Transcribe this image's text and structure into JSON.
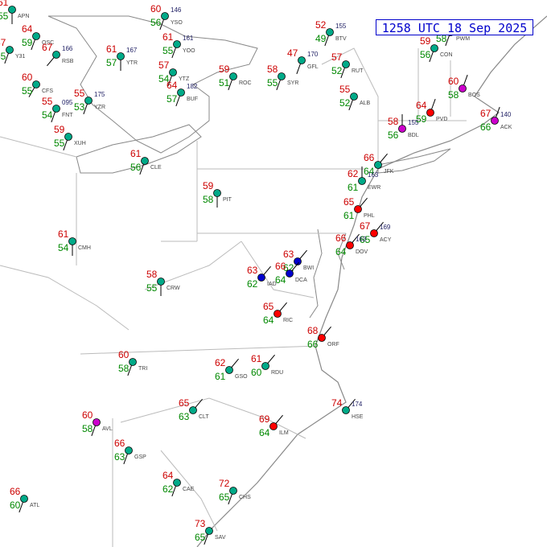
{
  "header": {
    "timestamp": "1258 UTC 18 Sep 2025"
  },
  "legend_colors": {
    "temperature": "#cc0000",
    "dewpoint": "#008800",
    "pressure": "#222266",
    "state_border": "#bbbbbb",
    "coast": "#888888",
    "overcast": "#0000cc",
    "ceiling_low": "#cc00cc",
    "ceiling_marginal": "#ff0000",
    "mostly_clear": "#00aa88",
    "timestamp_box": "#0000cc"
  },
  "stations": [
    {
      "id": "APN",
      "temp": "61",
      "dew": "55",
      "press": "",
      "cover": "green",
      "wind": 180
    },
    {
      "id": "OSC",
      "temp": "64",
      "dew": "59",
      "press": "",
      "cover": "green",
      "wind": 200
    },
    {
      "id": "Y31",
      "temp": "67",
      "dew": "55",
      "press": "",
      "cover": "green",
      "wind": 200
    },
    {
      "id": "CFS",
      "temp": "60",
      "dew": "55",
      "press": "",
      "cover": "green",
      "wind": 210
    },
    {
      "id": "RSB",
      "temp": "67",
      "dew": "",
      "press": "166",
      "cover": "green",
      "wind": 220
    },
    {
      "id": "FNT",
      "temp": "55",
      "dew": "54",
      "press": "095",
      "cover": "green",
      "wind": 200
    },
    {
      "id": "YZR",
      "temp": "55",
      "dew": "53",
      "press": "175",
      "cover": "green",
      "wind": 200
    },
    {
      "id": "XUH",
      "temp": "59",
      "dew": "55",
      "press": "",
      "cover": "green",
      "wind": 200
    },
    {
      "id": "YTR",
      "temp": "61",
      "dew": "57",
      "press": "167",
      "cover": "green",
      "wind": 180
    },
    {
      "id": "YSO",
      "temp": "60",
      "dew": "56",
      "press": "146",
      "cover": "green",
      "wind": 200
    },
    {
      "id": "YOO",
      "temp": "61",
      "dew": "55",
      "press": "161",
      "cover": "green",
      "wind": 200
    },
    {
      "id": "YTZ",
      "temp": "57",
      "dew": "54",
      "press": "",
      "cover": "green",
      "wind": 200
    },
    {
      "id": "BUF",
      "temp": "64",
      "dew": "57",
      "press": "182",
      "cover": "green",
      "wind": 200
    },
    {
      "id": "ROC",
      "temp": "59",
      "dew": "51",
      "press": "",
      "cover": "green",
      "wind": 200
    },
    {
      "id": "SYR",
      "temp": "58",
      "dew": "55",
      "press": "",
      "cover": "green",
      "wind": 200
    },
    {
      "id": "ALB",
      "temp": "55",
      "dew": "52",
      "press": "",
      "cover": "green",
      "wind": 200
    },
    {
      "id": "GFL",
      "temp": "47",
      "dew": "",
      "press": "170",
      "cover": "green",
      "wind": 200
    },
    {
      "id": "BTV",
      "temp": "52",
      "dew": "49",
      "press": "155",
      "cover": "green",
      "wind": 200
    },
    {
      "id": "RUT",
      "temp": "57",
      "dew": "52",
      "press": "",
      "cover": "green",
      "wind": 200
    },
    {
      "id": "CON",
      "temp": "59",
      "dew": "56",
      "press": "",
      "cover": "green",
      "wind": 200
    },
    {
      "id": "PWM",
      "temp": "59",
      "dew": "58",
      "press": "",
      "cover": "green",
      "wind": 200
    },
    {
      "id": "BOS",
      "temp": "60",
      "dew": "58",
      "press": "",
      "cover": "magenta",
      "wind": 20
    },
    {
      "id": "PVD",
      "temp": "64",
      "dew": "59",
      "press": "",
      "cover": "red",
      "wind": 20
    },
    {
      "id": "ACK",
      "temp": "67",
      "dew": "66",
      "press": "140",
      "cover": "magenta",
      "wind": 20
    },
    {
      "id": "BDL",
      "temp": "58",
      "dew": "56",
      "press": "155",
      "cover": "magenta",
      "wind": 0
    },
    {
      "id": "JFK",
      "temp": "66",
      "dew": "64",
      "press": "",
      "cover": "green",
      "wind": 40
    },
    {
      "id": "EWR",
      "temp": "62",
      "dew": "61",
      "press": "163",
      "cover": "green",
      "wind": 0
    },
    {
      "id": "PHL",
      "temp": "65",
      "dew": "61",
      "press": "",
      "cover": "red",
      "wind": 40
    },
    {
      "id": "ACY",
      "temp": "67",
      "dew": "65",
      "press": "169",
      "cover": "red",
      "wind": 40
    },
    {
      "id": "DOV",
      "temp": "66",
      "dew": "64",
      "press": "163",
      "cover": "red",
      "wind": 40
    },
    {
      "id": "BWI",
      "temp": "63",
      "dew": "62",
      "press": "",
      "cover": "blue",
      "wind": 40
    },
    {
      "id": "DCA",
      "temp": "66",
      "dew": "64",
      "press": "",
      "cover": "blue",
      "wind": 40
    },
    {
      "id": "IAD",
      "temp": "63",
      "dew": "62",
      "press": "",
      "cover": "blue",
      "wind": 40
    },
    {
      "id": "RIC",
      "temp": "65",
      "dew": "64",
      "press": "",
      "cover": "red",
      "wind": 40
    },
    {
      "id": "ORF",
      "temp": "68",
      "dew": "66",
      "press": "",
      "cover": "red",
      "wind": 40
    },
    {
      "id": "RDU",
      "temp": "61",
      "dew": "60",
      "press": "",
      "cover": "green",
      "wind": 40
    },
    {
      "id": "GSO",
      "temp": "62",
      "dew": "61",
      "press": "",
      "cover": "green",
      "wind": 40
    },
    {
      "id": "CLT",
      "temp": "65",
      "dew": "63",
      "press": "",
      "cover": "green",
      "wind": 40
    },
    {
      "id": "ILM",
      "temp": "69",
      "dew": "64",
      "press": "",
      "cover": "red",
      "wind": 40
    },
    {
      "id": "HSE",
      "temp": "74",
      "dew": "",
      "press": "174",
      "cover": "green",
      "wind": 40
    },
    {
      "id": "CRW",
      "temp": "58",
      "dew": "55",
      "press": "",
      "cover": "green",
      "wind": 180
    },
    {
      "id": "PIT",
      "temp": "59",
      "dew": "58",
      "press": "",
      "cover": "green",
      "wind": 180
    },
    {
      "id": "CLE",
      "temp": "61",
      "dew": "56",
      "press": "",
      "cover": "green",
      "wind": 200
    },
    {
      "id": "CMH",
      "temp": "61",
      "dew": "54",
      "press": "",
      "cover": "green",
      "wind": 180
    },
    {
      "id": "TRI",
      "temp": "60",
      "dew": "58",
      "press": "",
      "cover": "green",
      "wind": 200
    },
    {
      "id": "AVL",
      "temp": "60",
      "dew": "58",
      "press": "",
      "cover": "magenta",
      "wind": 200
    },
    {
      "id": "GSP",
      "temp": "66",
      "dew": "63",
      "press": "",
      "cover": "green",
      "wind": 200
    },
    {
      "id": "CAE",
      "temp": "64",
      "dew": "62",
      "press": "",
      "cover": "green",
      "wind": 200
    },
    {
      "id": "CHS",
      "temp": "72",
      "dew": "65",
      "press": "",
      "cover": "green",
      "wind": 200
    },
    {
      "id": "SAV",
      "temp": "73",
      "dew": "65",
      "press": "",
      "cover": "green",
      "wind": 200
    },
    {
      "id": "ATL",
      "temp": "66",
      "dew": "60",
      "press": "",
      "cover": "green",
      "wind": 200
    }
  ]
}
